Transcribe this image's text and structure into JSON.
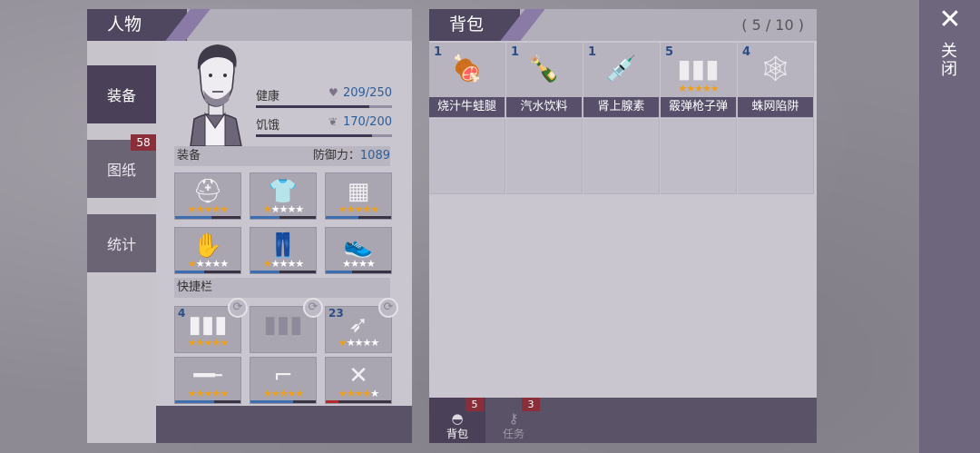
{
  "character": {
    "title": "人物",
    "tabs": [
      {
        "label": "装备",
        "badge": ""
      },
      {
        "label": "图纸",
        "badge": "58"
      },
      {
        "label": "统计",
        "badge": ""
      }
    ],
    "stats": {
      "health": {
        "label": "健康",
        "value": "209/250",
        "fraction": 0.836
      },
      "hunger": {
        "label": "饥饿",
        "value": "170/200",
        "fraction": 0.85
      }
    },
    "equipment": {
      "title": "装备",
      "defense_label": "防御力：",
      "defense_value": "1089",
      "slots": [
        {
          "icon": "helmet-icon",
          "glyph": "⛑",
          "stars": 5,
          "dur": 0.55
        },
        {
          "icon": "jacket-icon",
          "glyph": "👕",
          "stars": 1,
          "dur": 0.45
        },
        {
          "icon": "vest-icon",
          "glyph": "▦",
          "stars": 5,
          "dur": 0.5
        },
        {
          "icon": "gloves-icon",
          "glyph": "✋",
          "stars": 1,
          "dur": 0.45
        },
        {
          "icon": "pants-icon",
          "glyph": "👖",
          "stars": 1,
          "dur": 0.45
        },
        {
          "icon": "boots-icon",
          "glyph": "👟",
          "stars": 0,
          "dur": 0.4
        }
      ]
    },
    "quickbar": {
      "title": "快捷栏",
      "slots": [
        {
          "icon": "shotgun-shells-icon",
          "glyph": "▮▮▮",
          "count": "4",
          "stars": 5,
          "swap": true,
          "dur": 0
        },
        {
          "icon": "empty-ammo-slot-icon",
          "glyph": "▮▮▮",
          "count": "",
          "stars": -1,
          "swap": true,
          "dur": 0
        },
        {
          "icon": "bow-arrow-icon",
          "glyph": "➶",
          "count": "23",
          "stars": 1,
          "swap": true,
          "dur": 0
        },
        {
          "icon": "shotgun-icon",
          "glyph": "━╾",
          "count": "",
          "stars": 5,
          "swap": false,
          "dur": 0.6
        },
        {
          "icon": "revolver-icon",
          "glyph": "⌐",
          "count": "",
          "stars": 5,
          "swap": false,
          "dur": 0.65
        },
        {
          "icon": "crossbow-icon",
          "glyph": "✕",
          "count": "",
          "stars": 4,
          "swap": false,
          "dur": 0.2,
          "dur_red": true
        }
      ]
    }
  },
  "backpack": {
    "title": "背包",
    "capacity": "( 5 / 10 )",
    "items": [
      {
        "name": "烧汁牛蛙腿",
        "count": "1",
        "icon": "frog-legs-icon",
        "glyph": "🍖",
        "stars": 0
      },
      {
        "name": "汽水饮料",
        "count": "1",
        "icon": "soda-bottle-icon",
        "glyph": "🍾",
        "stars": 0
      },
      {
        "name": "肾上腺素",
        "count": "1",
        "icon": "syringe-icon",
        "glyph": "💉",
        "stars": 0
      },
      {
        "name": "霰弹枪子弹",
        "count": "5",
        "icon": "shotgun-shells-icon",
        "glyph": "▮▮▮",
        "stars": 5
      },
      {
        "name": "蛛网陷阱",
        "count": "4",
        "icon": "spiderweb-trap-icon",
        "glyph": "🕸",
        "stars": 0
      }
    ],
    "tabs": [
      {
        "label": "背包",
        "badge": "5",
        "icon": "backpack-icon",
        "glyph": "◓"
      },
      {
        "label": "任务",
        "badge": "3",
        "icon": "key-icon",
        "glyph": "⚷"
      }
    ]
  },
  "close": {
    "label": "关闭",
    "glyph": "✕"
  },
  "colors": {
    "accent": "#4f4660",
    "star": "#f0a018",
    "badge": "#8a2f3a",
    "value": "#2a5d9a"
  }
}
